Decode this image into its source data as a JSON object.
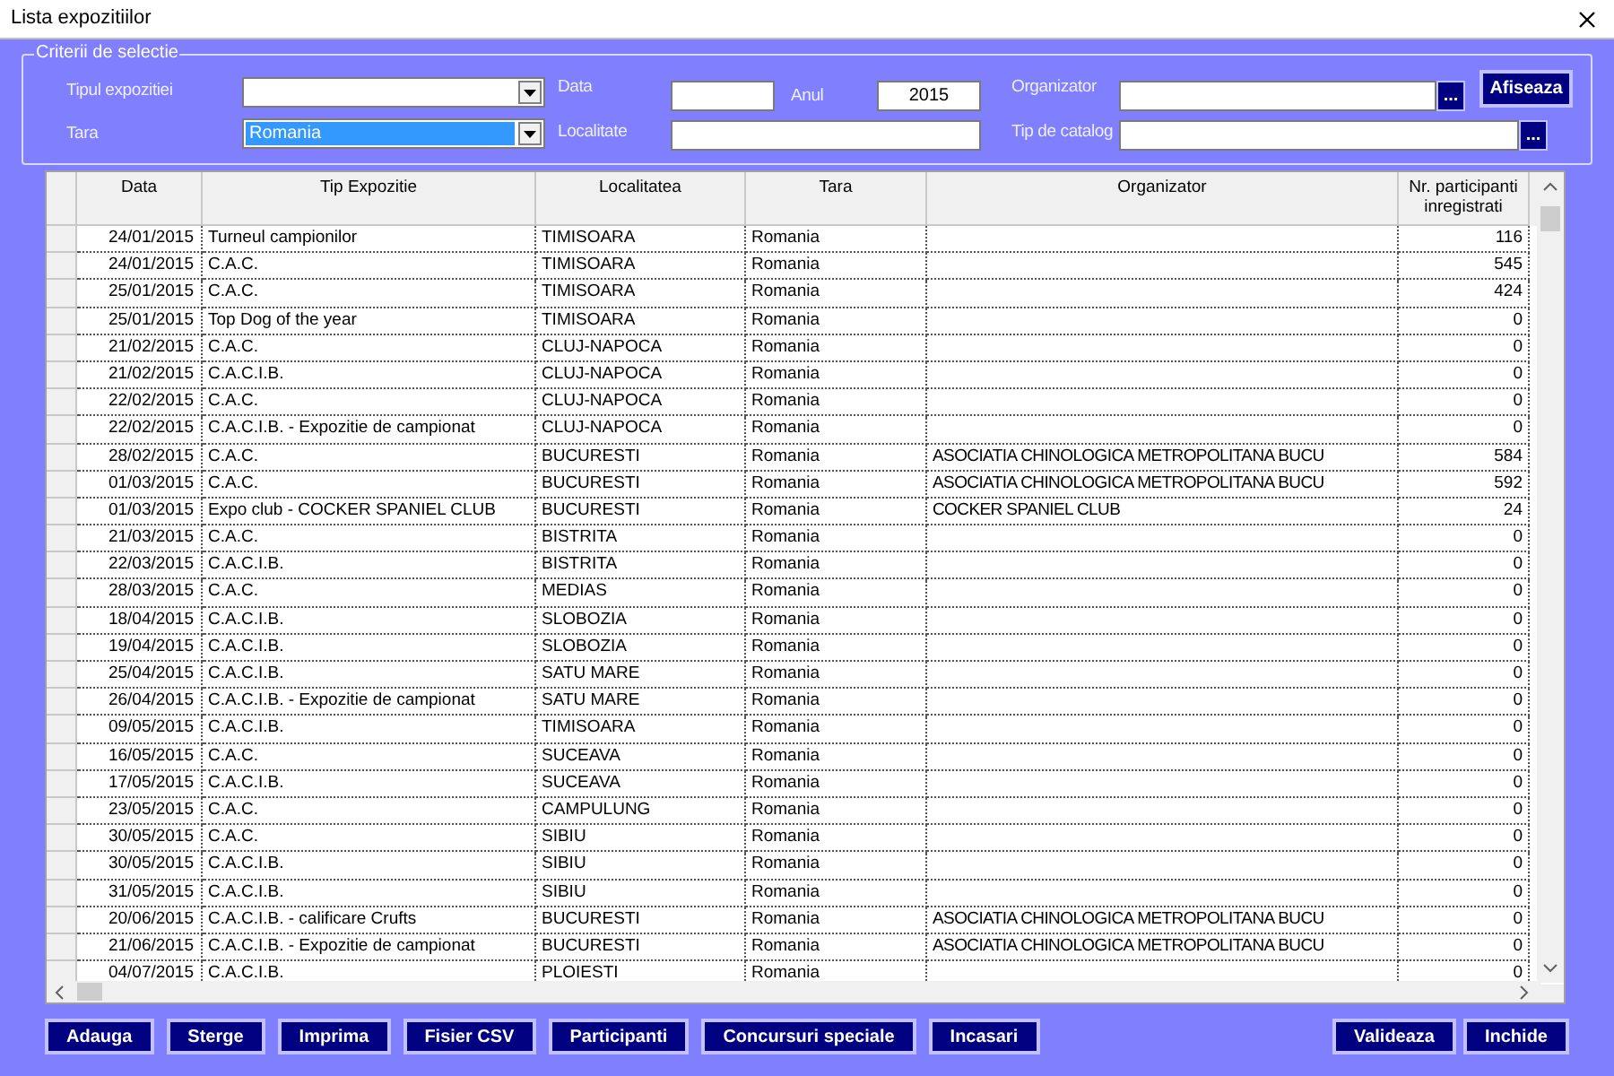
{
  "window": {
    "title": "Lista expozitiilor"
  },
  "filters": {
    "legend": "Criterii de selectie",
    "tip_expozitie": {
      "label": "Tipul expozitiei"
    },
    "data": {
      "label": "Data"
    },
    "anul": {
      "label": "Anul",
      "value": "2015"
    },
    "organizator": {
      "label": "Organizator",
      "button": "..."
    },
    "show_button": "Afiseaza",
    "tara": {
      "label": "Tara",
      "value": "Romania",
      "focused": true
    },
    "localitatea": {
      "label": "Localitate"
    },
    "tip_catalog": {
      "label": "Tip de catalog",
      "button": "..."
    }
  },
  "table": {
    "columns": [
      "Data",
      "Tip Expozitie",
      "Localitatea",
      "Tara",
      "Organizator",
      "Nr. participanti inregistrati"
    ],
    "rows": [
      [
        "24/01/2015",
        "Turneul campionilor",
        "TIMISOARA",
        "Romania",
        "",
        "116"
      ],
      [
        "24/01/2015",
        "C.A.C.",
        "TIMISOARA",
        "Romania",
        "",
        "545"
      ],
      [
        "25/01/2015",
        "C.A.C.",
        "TIMISOARA",
        "Romania",
        "",
        "424"
      ],
      [
        "25/01/2015",
        "Top Dog of the year",
        "TIMISOARA",
        "Romania",
        "",
        "0"
      ],
      [
        "21/02/2015",
        "C.A.C.",
        "CLUJ-NAPOCA",
        "Romania",
        "",
        "0"
      ],
      [
        "21/02/2015",
        "C.A.C.I.B.",
        "CLUJ-NAPOCA",
        "Romania",
        "",
        "0"
      ],
      [
        "22/02/2015",
        "C.A.C.",
        "CLUJ-NAPOCA",
        "Romania",
        "",
        "0"
      ],
      [
        "22/02/2015",
        "C.A.C.I.B. - Expozitie de campionat",
        "CLUJ-NAPOCA",
        "Romania",
        "",
        "0"
      ],
      [
        "28/02/2015",
        "C.A.C.",
        "BUCURESTI",
        "Romania",
        "ASOCIATIA CHINOLOGICA METROPOLITANA BUCU",
        "584"
      ],
      [
        "01/03/2015",
        "C.A.C.",
        "BUCURESTI",
        "Romania",
        "ASOCIATIA CHINOLOGICA METROPOLITANA BUCU",
        "592"
      ],
      [
        "01/03/2015",
        "Expo club - COCKER SPANIEL CLUB",
        "BUCURESTI",
        "Romania",
        "COCKER SPANIEL CLUB",
        "24"
      ],
      [
        "21/03/2015",
        "C.A.C.",
        "BISTRITA",
        "Romania",
        "",
        "0"
      ],
      [
        "22/03/2015",
        "C.A.C.I.B.",
        "BISTRITA",
        "Romania",
        "",
        "0"
      ],
      [
        "28/03/2015",
        "C.A.C.",
        "MEDIAS",
        "Romania",
        "",
        "0"
      ],
      [
        "18/04/2015",
        "C.A.C.I.B.",
        "SLOBOZIA",
        "Romania",
        "",
        "0"
      ],
      [
        "19/04/2015",
        "C.A.C.I.B.",
        "SLOBOZIA",
        "Romania",
        "",
        "0"
      ],
      [
        "25/04/2015",
        "C.A.C.I.B.",
        "SATU MARE",
        "Romania",
        "",
        "0"
      ],
      [
        "26/04/2015",
        "C.A.C.I.B. - Expozitie de campionat",
        "SATU MARE",
        "Romania",
        "",
        "0"
      ],
      [
        "09/05/2015",
        "C.A.C.I.B.",
        "TIMISOARA",
        "Romania",
        "",
        "0"
      ],
      [
        "16/05/2015",
        "C.A.C.",
        "SUCEAVA",
        "Romania",
        "",
        "0"
      ],
      [
        "17/05/2015",
        "C.A.C.I.B.",
        "SUCEAVA",
        "Romania",
        "",
        "0"
      ],
      [
        "23/05/2015",
        "C.A.C.",
        "CAMPULUNG",
        "Romania",
        "",
        "0"
      ],
      [
        "30/05/2015",
        "C.A.C.",
        "SIBIU",
        "Romania",
        "",
        "0"
      ],
      [
        "30/05/2015",
        "C.A.C.I.B.",
        "SIBIU",
        "Romania",
        "",
        "0"
      ],
      [
        "31/05/2015",
        "C.A.C.I.B.",
        "SIBIU",
        "Romania",
        "",
        "0"
      ],
      [
        "20/06/2015",
        "C.A.C.I.B. - calificare Crufts",
        "BUCURESTI",
        "Romania",
        "ASOCIATIA CHINOLOGICA METROPOLITANA BUCU",
        "0"
      ],
      [
        "21/06/2015",
        "C.A.C.I.B. - Expozitie de campionat",
        "BUCURESTI",
        "Romania",
        "ASOCIATIA CHINOLOGICA METROPOLITANA BUCU",
        "0"
      ],
      [
        "04/07/2015",
        "C.A.C.I.B.",
        "PLOIESTI",
        "Romania",
        "",
        "0"
      ]
    ]
  },
  "buttons_left": [
    "Adauga",
    "Sterge",
    "Imprima",
    "Fisier CSV",
    "Participanti",
    "Concursuri speciale",
    "Incasari"
  ],
  "buttons_right": [
    "Valideaza",
    "Inchide"
  ]
}
